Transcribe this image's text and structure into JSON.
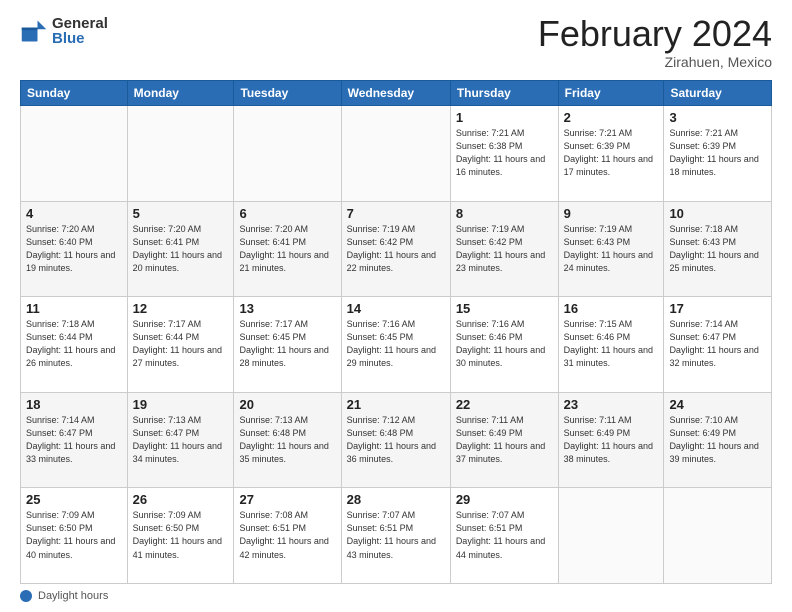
{
  "logo": {
    "general": "General",
    "blue": "Blue"
  },
  "header": {
    "month_year": "February 2024",
    "location": "Zirahuen, Mexico"
  },
  "days_of_week": [
    "Sunday",
    "Monday",
    "Tuesday",
    "Wednesday",
    "Thursday",
    "Friday",
    "Saturday"
  ],
  "weeks": [
    [
      {
        "day": "",
        "info": ""
      },
      {
        "day": "",
        "info": ""
      },
      {
        "day": "",
        "info": ""
      },
      {
        "day": "",
        "info": ""
      },
      {
        "day": "1",
        "info": "Sunrise: 7:21 AM\nSunset: 6:38 PM\nDaylight: 11 hours and 16 minutes."
      },
      {
        "day": "2",
        "info": "Sunrise: 7:21 AM\nSunset: 6:39 PM\nDaylight: 11 hours and 17 minutes."
      },
      {
        "day": "3",
        "info": "Sunrise: 7:21 AM\nSunset: 6:39 PM\nDaylight: 11 hours and 18 minutes."
      }
    ],
    [
      {
        "day": "4",
        "info": "Sunrise: 7:20 AM\nSunset: 6:40 PM\nDaylight: 11 hours and 19 minutes."
      },
      {
        "day": "5",
        "info": "Sunrise: 7:20 AM\nSunset: 6:41 PM\nDaylight: 11 hours and 20 minutes."
      },
      {
        "day": "6",
        "info": "Sunrise: 7:20 AM\nSunset: 6:41 PM\nDaylight: 11 hours and 21 minutes."
      },
      {
        "day": "7",
        "info": "Sunrise: 7:19 AM\nSunset: 6:42 PM\nDaylight: 11 hours and 22 minutes."
      },
      {
        "day": "8",
        "info": "Sunrise: 7:19 AM\nSunset: 6:42 PM\nDaylight: 11 hours and 23 minutes."
      },
      {
        "day": "9",
        "info": "Sunrise: 7:19 AM\nSunset: 6:43 PM\nDaylight: 11 hours and 24 minutes."
      },
      {
        "day": "10",
        "info": "Sunrise: 7:18 AM\nSunset: 6:43 PM\nDaylight: 11 hours and 25 minutes."
      }
    ],
    [
      {
        "day": "11",
        "info": "Sunrise: 7:18 AM\nSunset: 6:44 PM\nDaylight: 11 hours and 26 minutes."
      },
      {
        "day": "12",
        "info": "Sunrise: 7:17 AM\nSunset: 6:44 PM\nDaylight: 11 hours and 27 minutes."
      },
      {
        "day": "13",
        "info": "Sunrise: 7:17 AM\nSunset: 6:45 PM\nDaylight: 11 hours and 28 minutes."
      },
      {
        "day": "14",
        "info": "Sunrise: 7:16 AM\nSunset: 6:45 PM\nDaylight: 11 hours and 29 minutes."
      },
      {
        "day": "15",
        "info": "Sunrise: 7:16 AM\nSunset: 6:46 PM\nDaylight: 11 hours and 30 minutes."
      },
      {
        "day": "16",
        "info": "Sunrise: 7:15 AM\nSunset: 6:46 PM\nDaylight: 11 hours and 31 minutes."
      },
      {
        "day": "17",
        "info": "Sunrise: 7:14 AM\nSunset: 6:47 PM\nDaylight: 11 hours and 32 minutes."
      }
    ],
    [
      {
        "day": "18",
        "info": "Sunrise: 7:14 AM\nSunset: 6:47 PM\nDaylight: 11 hours and 33 minutes."
      },
      {
        "day": "19",
        "info": "Sunrise: 7:13 AM\nSunset: 6:47 PM\nDaylight: 11 hours and 34 minutes."
      },
      {
        "day": "20",
        "info": "Sunrise: 7:13 AM\nSunset: 6:48 PM\nDaylight: 11 hours and 35 minutes."
      },
      {
        "day": "21",
        "info": "Sunrise: 7:12 AM\nSunset: 6:48 PM\nDaylight: 11 hours and 36 minutes."
      },
      {
        "day": "22",
        "info": "Sunrise: 7:11 AM\nSunset: 6:49 PM\nDaylight: 11 hours and 37 minutes."
      },
      {
        "day": "23",
        "info": "Sunrise: 7:11 AM\nSunset: 6:49 PM\nDaylight: 11 hours and 38 minutes."
      },
      {
        "day": "24",
        "info": "Sunrise: 7:10 AM\nSunset: 6:49 PM\nDaylight: 11 hours and 39 minutes."
      }
    ],
    [
      {
        "day": "25",
        "info": "Sunrise: 7:09 AM\nSunset: 6:50 PM\nDaylight: 11 hours and 40 minutes."
      },
      {
        "day": "26",
        "info": "Sunrise: 7:09 AM\nSunset: 6:50 PM\nDaylight: 11 hours and 41 minutes."
      },
      {
        "day": "27",
        "info": "Sunrise: 7:08 AM\nSunset: 6:51 PM\nDaylight: 11 hours and 42 minutes."
      },
      {
        "day": "28",
        "info": "Sunrise: 7:07 AM\nSunset: 6:51 PM\nDaylight: 11 hours and 43 minutes."
      },
      {
        "day": "29",
        "info": "Sunrise: 7:07 AM\nSunset: 6:51 PM\nDaylight: 11 hours and 44 minutes."
      },
      {
        "day": "",
        "info": ""
      },
      {
        "day": "",
        "info": ""
      }
    ]
  ],
  "footer": {
    "daylight_label": "Daylight hours"
  }
}
